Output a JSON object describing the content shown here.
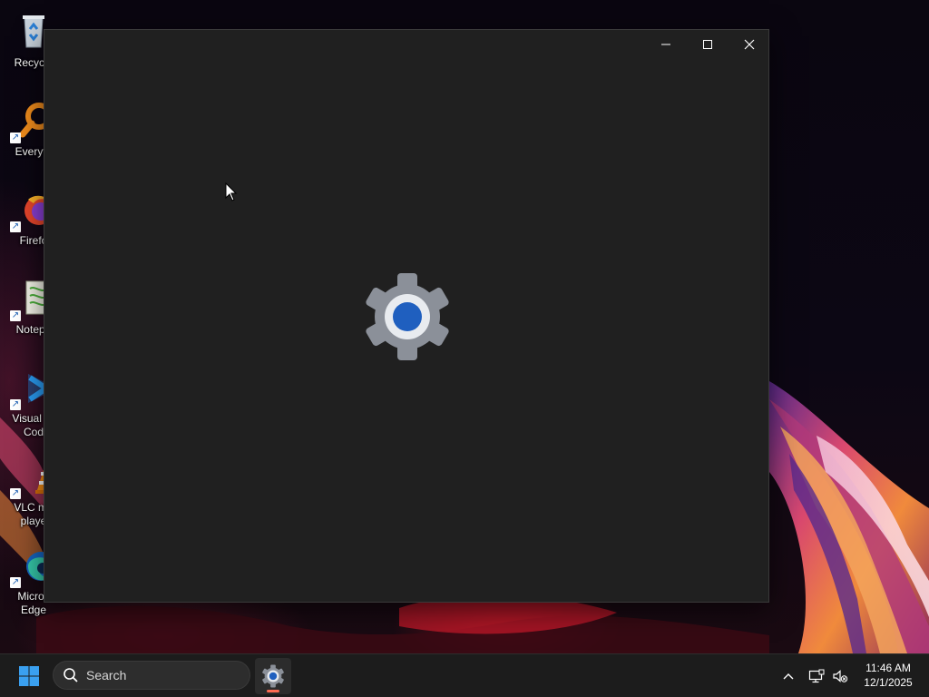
{
  "desktop": {
    "icons": [
      {
        "label": "Recycle",
        "icon": "recycle-bin-icon"
      },
      {
        "label": "Everyth",
        "icon": "everything-search-icon"
      },
      {
        "label": "Firefo",
        "icon": "firefox-icon"
      },
      {
        "label": "Notepa",
        "icon": "notepad-plus-plus-icon"
      },
      {
        "label": "Visual St\nCod",
        "icon": "vscode-icon"
      },
      {
        "label": "VLC me\nplaye",
        "icon": "vlc-icon"
      },
      {
        "label": "Micros\nEdge",
        "icon": "edge-icon"
      }
    ]
  },
  "window": {
    "title": "",
    "controls": {
      "minimize": "minimize-icon",
      "maximize": "maximize-icon",
      "close": "close-icon"
    },
    "splash_icon": "settings-gear-icon",
    "colors": {
      "background": "#202020",
      "gear_gray": "#8b9099",
      "gear_center": "#1f5fbf"
    }
  },
  "taskbar": {
    "start_icon": "windows-start-icon",
    "search": {
      "placeholder": "Search",
      "icon": "search-icon"
    },
    "pinned": [
      {
        "name": "Settings",
        "icon": "settings-gear-icon",
        "running": true
      }
    ],
    "tray": {
      "overflow_icon": "chevron-up-icon",
      "network_icon": "network-icon",
      "volume_icon": "volume-muted-icon"
    },
    "clock": {
      "time": "11:46 AM",
      "date": "12/1/2025"
    },
    "colors": {
      "background": "#1c1c1c",
      "running_indicator": "#ff6b52"
    }
  }
}
